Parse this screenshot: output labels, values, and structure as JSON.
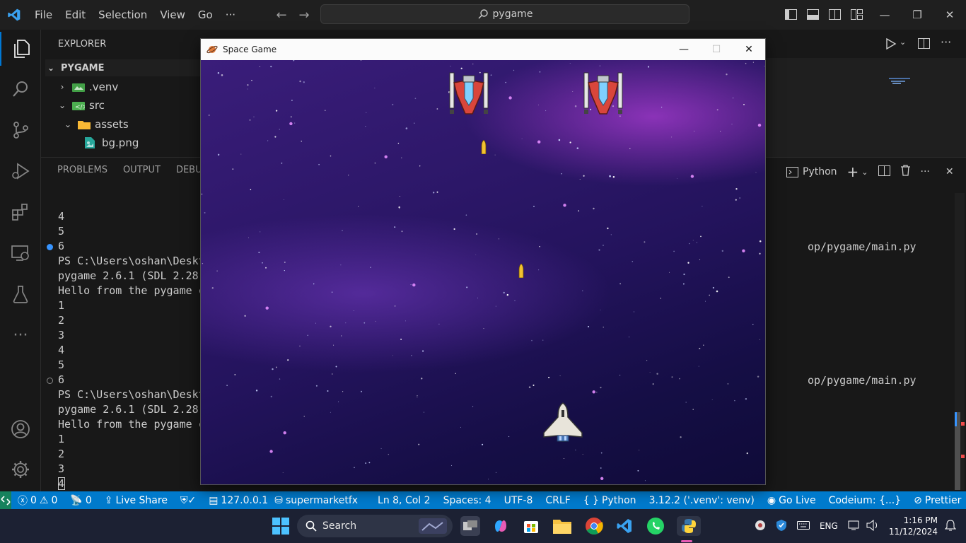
{
  "titlebar": {
    "menu": [
      "File",
      "Edit",
      "Selection",
      "View",
      "Go",
      "···"
    ],
    "command_center": "pygame"
  },
  "explorer": {
    "header": "EXPLORER",
    "root": "PYGAME",
    "items": [
      {
        "label": ".venv",
        "icon": "folder-env-icon",
        "expanded": false
      },
      {
        "label": "src",
        "icon": "folder-src-icon",
        "expanded": true
      },
      {
        "label": "assets",
        "icon": "folder-icon",
        "expanded": true
      },
      {
        "label": "bg.png",
        "icon": "image-file-icon"
      }
    ]
  },
  "panel": {
    "tabs": [
      "PROBLEMS",
      "OUTPUT",
      "DEBU"
    ],
    "shell_label": "Python",
    "terminal_lines": [
      "4",
      "5",
      "6",
      "PS C:\\Users\\oshan\\Deskt",
      "pygame 2.6.1 (SDL 2.28",
      "Hello from the pygame c",
      "1",
      "2",
      "3",
      "4",
      "5",
      "6",
      "PS C:\\Users\\oshan\\Deskt",
      "pygame 2.6.1 (SDL 2.28",
      "Hello from the pygame c",
      "1",
      "2",
      "3",
      "4"
    ],
    "terminal_right_1": "op/pygame/main.py",
    "terminal_right_2": "op/pygame/main.py"
  },
  "game_window": {
    "title": "Space Game",
    "colors": {
      "enemy": "#d9463b",
      "player": "#e8e4da",
      "bullet": "#f2c230"
    }
  },
  "statusbar": {
    "errors": "0",
    "warnings": "0",
    "ports": "0",
    "live_share": "Live Share",
    "host": "127.0.0.1",
    "db": "supermarketfx",
    "position": "Ln 8, Col 2",
    "spaces": "Spaces: 4",
    "encoding": "UTF-8",
    "eol": "CRLF",
    "language": "Python",
    "interpreter": "3.12.2 ('.venv': venv)",
    "go_live": "Go Live",
    "codeium": "Codeium: {...}",
    "prettier": "Prettier"
  },
  "taskbar": {
    "search": "Search",
    "lang": "ENG",
    "time": "1:16 PM",
    "date": "11/12/2024"
  }
}
